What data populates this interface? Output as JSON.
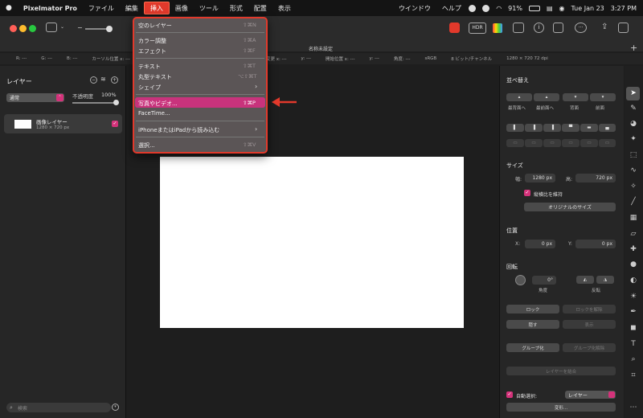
{
  "menubar": {
    "app": "Pixelmator Pro",
    "items": [
      "ファイル",
      "編集",
      "挿入",
      "画像",
      "ツール",
      "形式",
      "配置",
      "表示",
      "ウインドウ",
      "ヘルプ"
    ],
    "battery": "91%",
    "date": "Tue Jan 23",
    "time": "3:27 PM"
  },
  "toolbar": {
    "document_name": "名称未設定",
    "hdr_label": "HDR",
    "plus": "+"
  },
  "infobar": {
    "r": "R: ---",
    "g": "G: ---",
    "b": "B: ---",
    "cursor": "カーソル位置 x: ---",
    "y1": "y: ---",
    "size_change": "度の変更 x: ---",
    "y2": "y: ---",
    "start": "開始位置 x: ---",
    "y3": "y: ---",
    "angle": "角度: ---",
    "colorspace": "sRGB",
    "bitdepth": "8 ビット/チャンネル",
    "docsize": "1280 × 720 72 dpi"
  },
  "layers": {
    "title": "レイヤー",
    "blend_mode": "通常",
    "opacity_label": "不透明度",
    "opacity_value": "100%",
    "opacity_fraction": 1.0,
    "layer_name": "画像レイヤー",
    "layer_size": "1280 × 720 px",
    "search_placeholder": "検索"
  },
  "insert_menu": {
    "items": [
      {
        "label": "空のレイヤー",
        "shortcut": "⇧⌘N"
      },
      {
        "label": "カラー調整",
        "shortcut": "⇧⌘A"
      },
      {
        "label": "エフェクト",
        "shortcut": "⇧⌘F"
      },
      {
        "label": "テキスト",
        "shortcut": "⇧⌘T"
      },
      {
        "label": "丸型テキスト",
        "shortcut": "⌥⇧⌘T"
      },
      {
        "label": "シェイプ",
        "shortcut": "›"
      },
      {
        "label": "写真やビデオ...",
        "shortcut": "⇧⌘P"
      },
      {
        "label": "FaceTime...",
        "shortcut": ""
      },
      {
        "label": "iPhoneまたはiPadから読み込む",
        "shortcut": "›"
      },
      {
        "label": "選択...",
        "shortcut": "⇧⌘V"
      }
    ]
  },
  "arrange": {
    "title": "並べ替え",
    "front_most": "最背面へ",
    "front": "最前面へ",
    "back": "背面",
    "forward": "前面",
    "size_title": "サイズ",
    "width_label": "幅:",
    "width_value": "1280 px",
    "height_label": "高:",
    "height_value": "720 px",
    "keep_ratio": "縦横比を維持",
    "original_size": "オリジナルのサイズ",
    "position_title": "位置",
    "x_label": "X:",
    "x_value": "0 px",
    "y_label": "Y:",
    "y_value": "0 px",
    "rotate_title": "回転",
    "angle_value": "0°",
    "angle_label": "角度",
    "flip_label": "反転",
    "lock": "ロック",
    "unlock": "ロックを解除",
    "hide": "隠す",
    "show": "表示",
    "group": "グループ化",
    "ungroup": "グループ化解除",
    "merge": "レイヤーを結合",
    "auto_select": "自動選択:",
    "auto_select_value": "レイヤー",
    "transform": "変形..."
  },
  "colors": {
    "accent": "#d4327a",
    "highlight_red": "#e2392b"
  }
}
